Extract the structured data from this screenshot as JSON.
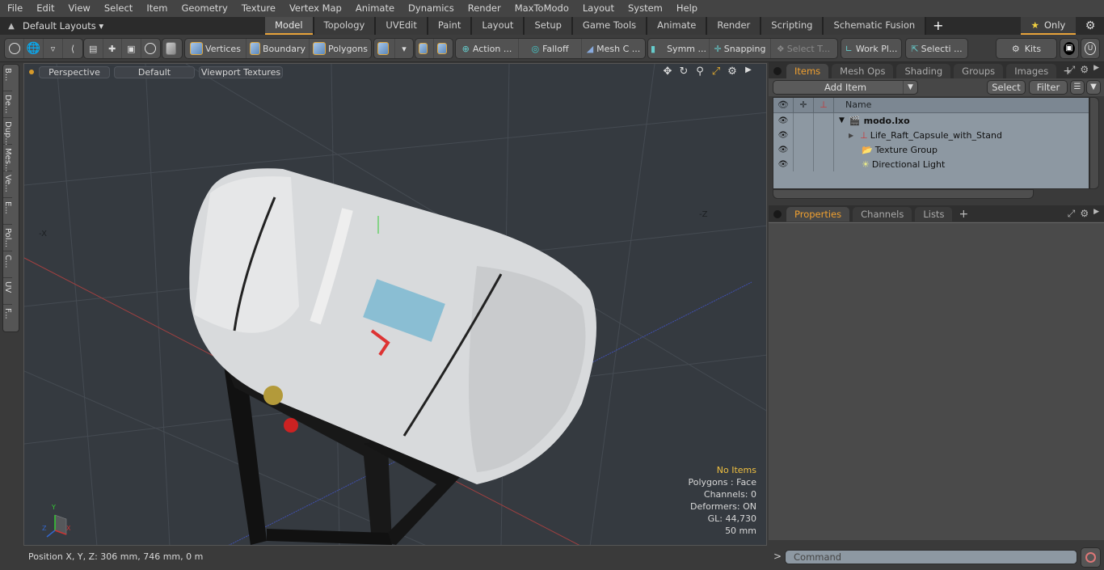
{
  "menu": [
    "File",
    "Edit",
    "View",
    "Select",
    "Item",
    "Geometry",
    "Texture",
    "Vertex Map",
    "Animate",
    "Dynamics",
    "Render",
    "MaxToModo",
    "Layout",
    "System",
    "Help"
  ],
  "layoutbar": {
    "layouts_label": "Default Layouts",
    "tabs": [
      "Model",
      "Topology",
      "UVEdit",
      "Paint",
      "Layout",
      "Setup",
      "Game Tools",
      "Animate",
      "Render",
      "Scripting",
      "Schematic Fusion"
    ],
    "active_tab": "Model",
    "only_label": "Only"
  },
  "toolbar": {
    "vertices": "Vertices",
    "boundary": "Boundary",
    "polygons": "Polygons",
    "action": "Action",
    "falloff": "Falloff",
    "mesh": "Mesh C ...",
    "symm": "Symm ...",
    "snapping": "Snapping",
    "select_t": "Select T...",
    "workplane": "Work Pl...",
    "selection": "Selecti ...",
    "kits": "Kits",
    "ellipsis": "..."
  },
  "left_tabs": [
    "B...",
    "De...",
    "Dup...",
    "Mes...",
    "Ve...",
    "E...",
    "Pol...",
    "C...",
    "UV",
    "F..."
  ],
  "viewport": {
    "view": "Perspective",
    "style": "Default",
    "textures": "Viewport Textures",
    "axis_labels": {
      "neg_x": "-X",
      "neg_z": "-Z"
    },
    "gizmo": {
      "x": "X",
      "y": "Y",
      "z": "Z"
    },
    "hud": {
      "selection": "No Items",
      "polygons": "Polygons : Face",
      "channels": "Channels: 0",
      "deformers": "Deformers: ON",
      "gl": "GL: 44,730",
      "scale": "50 mm"
    }
  },
  "status": {
    "position": "Position X, Y, Z:   306 mm, 746 mm, 0 m"
  },
  "items_panel": {
    "tabs": [
      "Items",
      "Mesh Ops",
      "Shading",
      "Groups",
      "Images"
    ],
    "active_tab": "Items",
    "add_item": "Add Item",
    "select": "Select",
    "filter": "Filter",
    "column_name": "Name",
    "rows": [
      {
        "name": "modo.lxo",
        "icon": "scene-icon",
        "indent": 0,
        "expanded": true
      },
      {
        "name": "Life_Raft_Capsule_with_Stand",
        "icon": "mesh-locator-icon",
        "indent": 1,
        "expanded": false
      },
      {
        "name": "Texture Group",
        "icon": "folder-icon",
        "indent": 1
      },
      {
        "name": "Directional Light",
        "icon": "light-icon",
        "indent": 1
      }
    ]
  },
  "properties_panel": {
    "tabs": [
      "Properties",
      "Channels",
      "Lists"
    ],
    "active_tab": "Properties"
  },
  "command": {
    "placeholder": "Command",
    "prompt": ">"
  },
  "colors": {
    "accent": "#e8a33a",
    "hud_warn": "#f0c040",
    "tree_bg": "#8d98a2",
    "viewport_bg": "#353a40"
  }
}
